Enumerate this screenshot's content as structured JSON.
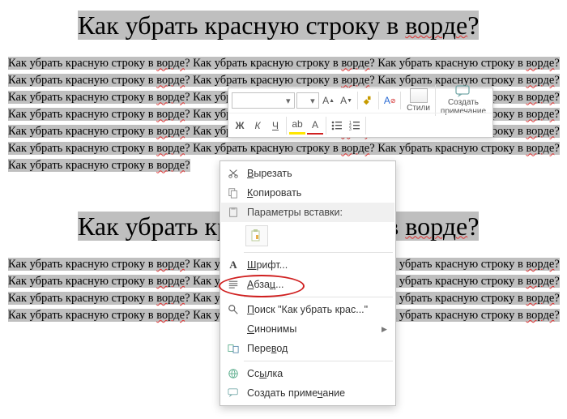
{
  "document": {
    "heading1": "Как убрать красную строку в ворде?",
    "heading2": "Как убрать красную строку в ворде?",
    "body_repeated": "Как убрать красную строку в ворде? ",
    "squiggle_word": "ворде"
  },
  "mini_toolbar": {
    "font_dropdown": "",
    "bold": "Ж",
    "italic": "К",
    "underline": "Ч",
    "styles_label": "Стили",
    "comment_label_line1": "Создать",
    "comment_label_line2": "примечание"
  },
  "context_menu": {
    "cut": "Вырезать",
    "copy": "Копировать",
    "paste_options_label": "Параметры вставки:",
    "font": "Шрифт...",
    "paragraph": "Абзац...",
    "search_prefix": "Поиск \"Как убрать крас...\"",
    "synonyms": "Синонимы",
    "translate": "Перевод",
    "link": "Ссылка",
    "new_comment": "Создать примечание"
  }
}
